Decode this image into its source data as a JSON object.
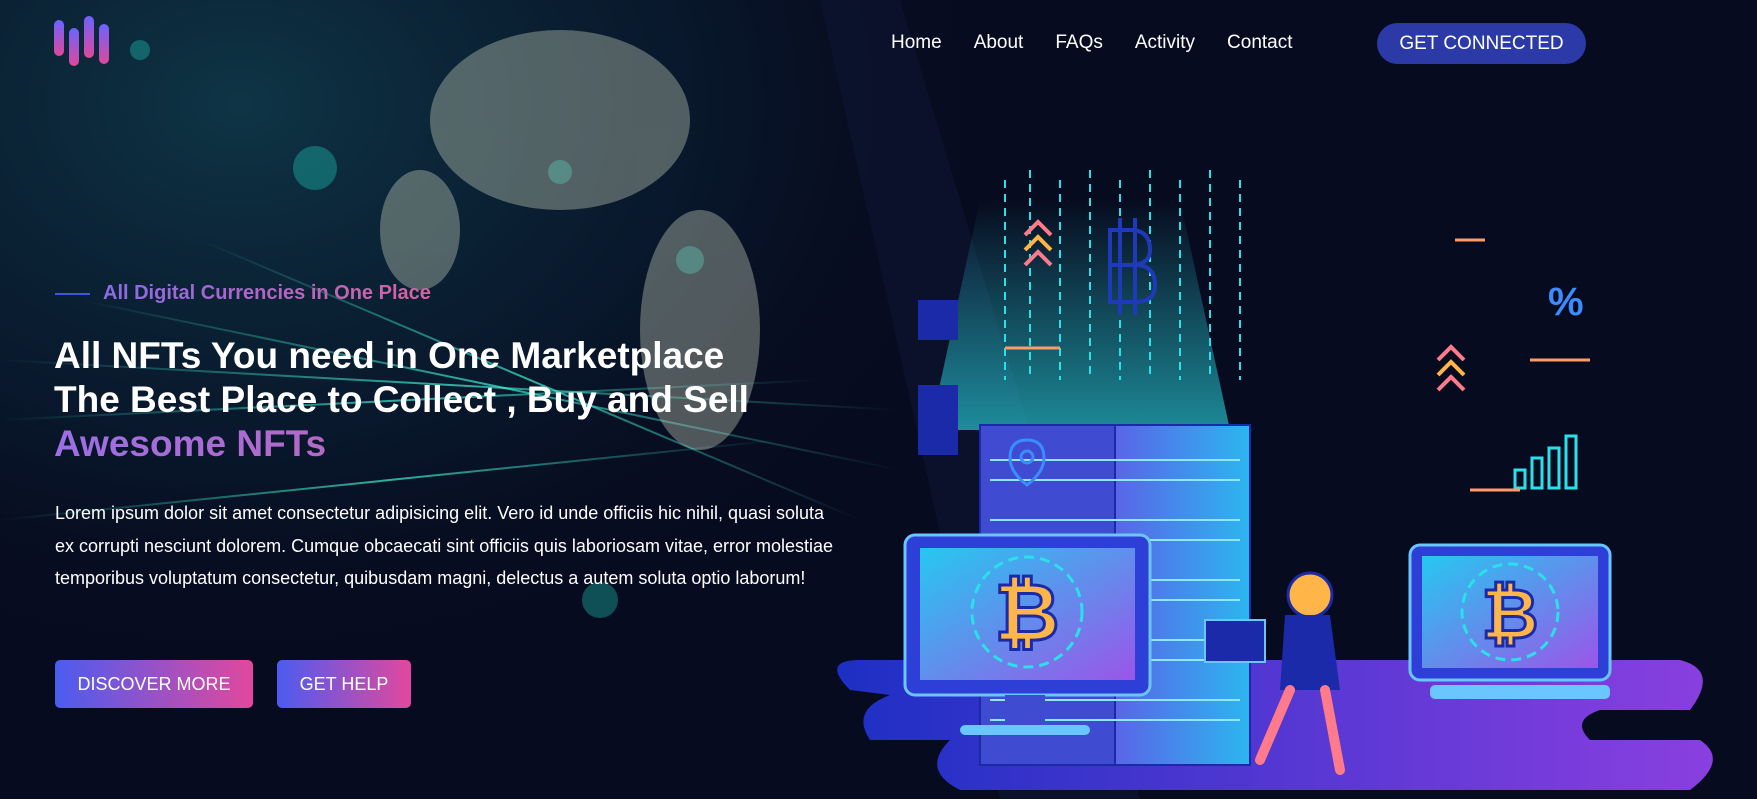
{
  "brand": {
    "logo_icon": "bars-logo-icon"
  },
  "nav": {
    "items": [
      "Home",
      "About",
      "FAQs",
      "Activity",
      "Contact"
    ]
  },
  "header": {
    "cta_label": "GET CONNECTED"
  },
  "hero": {
    "kicker": "All Digital Currencies in One Place",
    "title_line1": "All NFTs You need in One Marketplace",
    "title_line2": "The Best Place to Collect , Buy and Sell",
    "title_highlight": "Awesome NFTs",
    "description": "Lorem ipsum dolor sit amet consectetur adipisicing elit. Vero id unde officiis hic nihil, quasi soluta ex corrupti nesciunt dolorem. Cumque obcaecati sint officiis quis laboriosam vitae, error molestiae temporibus voluptatum consectetur, quibusdam magni, delectus a autem soluta optio laborum!",
    "button_primary": "DISCOVER MORE",
    "button_secondary": "GET HELP"
  },
  "illustration": {
    "percent_symbol": "%"
  },
  "colors": {
    "accent_blue": "#2b3aa6",
    "gradient_start": "#4b5cf0",
    "gradient_end": "#e2489d",
    "cyan": "#22e1f0",
    "background": "#070b1f"
  }
}
